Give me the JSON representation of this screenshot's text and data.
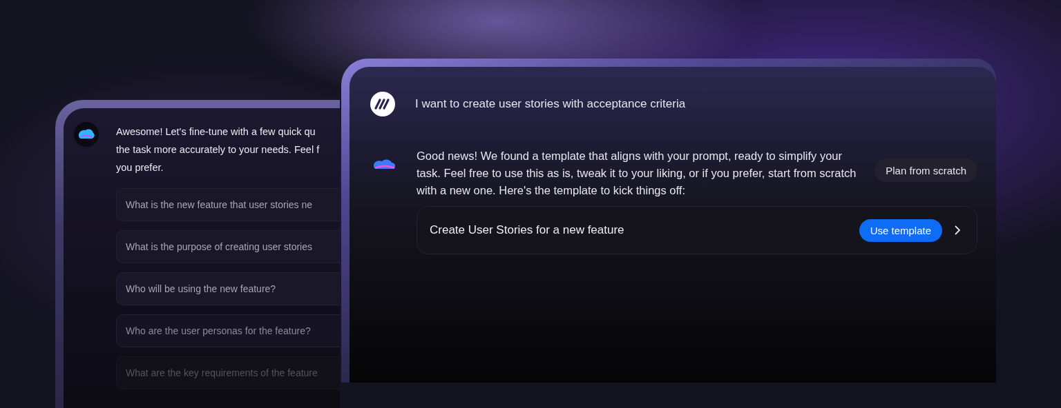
{
  "back_chat": {
    "message_lines": [
      "Awesome! Let's fine-tune with a few quick qu",
      "the task more accurately to your needs. Feel f",
      "you prefer."
    ],
    "questions": [
      "What is the new feature that user stories ne",
      "What is the purpose of creating user stories",
      "Who will be using the new feature?",
      "Who are the user personas for the feature?",
      "What are the key requirements of the feature"
    ]
  },
  "front_chat": {
    "user_message": "I want to create user stories with acceptance criteria",
    "reply": "Good news! We found a template that aligns with your prompt, ready to simplify your task. Feel free to use this as is, tweak it to your liking, or if you prefer, start from scratch with a new one. Here's the template to kick things off:",
    "plan_button": "Plan from scratch",
    "template": {
      "title": "Create User Stories for a new feature",
      "button": "Use template"
    }
  }
}
